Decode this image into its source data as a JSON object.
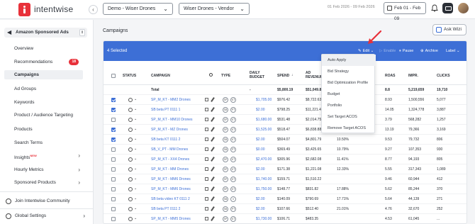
{
  "topbar": {
    "brand": "intentwise",
    "account_select": "Demo - Wiser Drones",
    "profile_select": "Wiser Drones - Vendor",
    "date_range": "01 Feb 2026 - 09 Feb 2026",
    "date_button": "Feb 01 - Feb 09"
  },
  "sidebar": {
    "ads_type": "Amazon Sponsored Ads",
    "items": [
      {
        "label": "Overview"
      },
      {
        "label": "Recommendations",
        "badge": "18"
      },
      {
        "label": "Campaigns"
      },
      {
        "label": "Ad Groups"
      },
      {
        "label": "Keywords"
      },
      {
        "label": "Product / Audience Targeting"
      },
      {
        "label": "Products"
      },
      {
        "label": "Search Terms"
      },
      {
        "label": "Insights",
        "tag": "NEW"
      },
      {
        "label": "Hourly Metrics"
      },
      {
        "label": "Sponsored Products"
      }
    ],
    "community": "Join Intentwise Community",
    "global_settings": "Global Settings"
  },
  "main": {
    "title": "Campaigns",
    "ask_wizi": "Ask Wizi",
    "selection": {
      "count_label": "4 Selected",
      "actions": {
        "edit": "Edit",
        "enable": "Enable",
        "pause": "Pause",
        "archive": "Archive",
        "label": "Label"
      }
    },
    "edit_menu": [
      "Auto Apply",
      "Bid Strategy",
      "Bid Optimization Profile",
      "Budget",
      "Portfolio",
      "Set Target ACOS",
      "Remove Target ACOS"
    ],
    "columns": {
      "status": "STATUS",
      "campaign": "CAMPAIGN",
      "type": "TYPE",
      "daily_budget_1": "DAILY",
      "daily_budget_2": "BUDGET",
      "spend": "SPEND",
      "ad_revenue_1": "AD",
      "ad_revenue_2": "REVENUE",
      "roas": "ROAS",
      "impr": "IMPR.",
      "clicks": "CLICKS"
    },
    "total": {
      "label": "Total",
      "daily_budget": "-",
      "spend": "$5,800.19",
      "ad_revenue": "$51,049.8",
      "roas": "8.8",
      "impr": "5,219,659",
      "clicks": "19,710"
    },
    "rows": [
      {
        "checked": true,
        "campaign": "SP_M_KT - MM2 Drones",
        "type": [
          "SP",
          "KT"
        ],
        "budget": "$1,705.00",
        "spend": "$976.42",
        "revenue": "$8,722.63",
        "acos": "",
        "roas": "8.93",
        "impr": "1,500,556",
        "clicks": "5,077"
      },
      {
        "checked": true,
        "campaign": "SB beta PT 0111 1",
        "type": [
          "SB",
          "PT"
        ],
        "budget": "$2.00",
        "spend": "$798.25",
        "revenue": "$11,221.43",
        "acos": "",
        "roas": "14.05",
        "impr": "1,324,778",
        "clicks": "3,887"
      },
      {
        "checked": false,
        "campaign": "SP_M_KT - MM10 Drones",
        "type": [
          "SP",
          "KT"
        ],
        "budget": "$1,680.00",
        "spend": "$531.48",
        "revenue": "$2,014.75",
        "acos": "",
        "roas": "3.79",
        "impr": "568,282",
        "clicks": "1,257"
      },
      {
        "checked": true,
        "campaign": "SP_M_KT - MZ Drones",
        "type": [
          "SP",
          "KT"
        ],
        "budget": "$1,525.00",
        "spend": "$518.47",
        "revenue": "$6,838.88",
        "acos": "",
        "roas": "13.19",
        "impr": "79,366",
        "clicks": "3,169"
      },
      {
        "checked": true,
        "campaign": "SB beta KT 0111 2",
        "type": [
          "SB",
          "KT"
        ],
        "budget": "$2.00",
        "spend": "$504.07",
        "revenue": "$4,801.79",
        "acos": "10.50%",
        "roas": "9.53",
        "impr": "79,732",
        "clicks": "806"
      },
      {
        "checked": false,
        "campaign": "SB_V_PT - MM Drones",
        "type": [
          "SB",
          "PT"
        ],
        "budget": "$0.00",
        "spend": "$369.49",
        "revenue": "$3,425.65",
        "acos": "10.79%",
        "roas": "9.27",
        "impr": "107,353",
        "clicks": "930"
      },
      {
        "checked": false,
        "campaign": "SP_M_KT - XX4 Drones",
        "type": [
          "SP",
          "KT"
        ],
        "budget": "$2,470.00",
        "spend": "$305.96",
        "revenue": "$2,682.08",
        "acos": "11.41%",
        "roas": "8.77",
        "impr": "94,193",
        "clicks": "805"
      },
      {
        "checked": false,
        "campaign": "SP_M_KT - MM Drones",
        "type": [
          "SP",
          "KT"
        ],
        "budget": "$2.00",
        "spend": "$171.38",
        "revenue": "$1,221.08",
        "acos": "12.33%",
        "roas": "5.55",
        "impr": "317,343",
        "clicks": "1,089"
      },
      {
        "checked": false,
        "campaign": "SP_M_KT - MM6 Drones",
        "type": [
          "SP",
          "KT"
        ],
        "budget": "$1,740.00",
        "spend": "$159.71",
        "revenue": "$1,510.22",
        "acos": "",
        "roas": "9.46",
        "impr": "60,944",
        "clicks": "412"
      },
      {
        "checked": false,
        "campaign": "SP_M_KT - MM6 Drones",
        "type": [
          "SP",
          "KT"
        ],
        "budget": "$1,750.00",
        "spend": "$148.77",
        "revenue": "$831.82",
        "acos": "17.88%",
        "roas": "5.62",
        "impr": "85,244",
        "clicks": "370"
      },
      {
        "checked": false,
        "campaign": "SB beta video KT 0111 2",
        "type": [
          "SB",
          "V"
        ],
        "budget": "$2.00",
        "spend": "$140.09",
        "revenue": "$790.69",
        "acos": "17.71%",
        "roas": "5.64",
        "impr": "44,139",
        "clicks": "271"
      },
      {
        "checked": false,
        "campaign": "SB beta PT 0111 2",
        "type": [
          "SB",
          "PT"
        ],
        "budget": "$2.00",
        "spend": "$107.66",
        "revenue": "$512.40",
        "acos": "21.01%",
        "roas": "4.76",
        "impr": "32,670",
        "clicks": "252"
      },
      {
        "checked": false,
        "campaign": "SP_M_KT - MM5 Drones",
        "type": [
          "SP",
          "KT"
        ],
        "budget": "$1,730.00",
        "spend": "$106.71",
        "revenue": "$483.35",
        "acos": "",
        "roas": "4.53",
        "impr": "61,045",
        "clicks": "..."
      }
    ]
  },
  "colors": {
    "accent": "#3d6fd6",
    "brand": "#e8313a"
  }
}
